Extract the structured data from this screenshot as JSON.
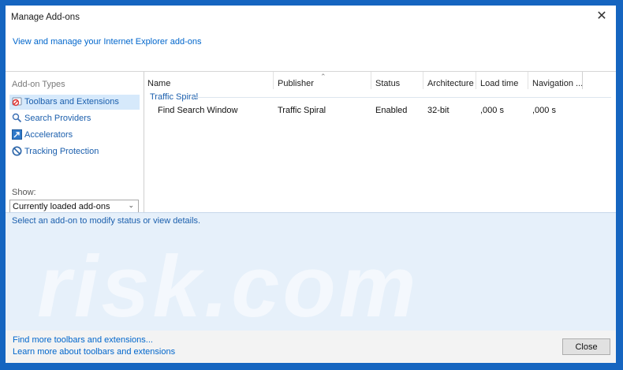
{
  "window": {
    "title": "Manage Add-ons",
    "close_glyph": "✕",
    "header_link": "View and manage your Internet Explorer add-ons"
  },
  "sidebar": {
    "types_label": "Add-on Types",
    "items": [
      {
        "label": "Toolbars and Extensions",
        "icon": "toolbars-extensions-icon",
        "selected": true
      },
      {
        "label": "Search Providers",
        "icon": "search-icon",
        "selected": false
      },
      {
        "label": "Accelerators",
        "icon": "accelerators-icon",
        "selected": false
      },
      {
        "label": "Tracking Protection",
        "icon": "tracking-protection-icon",
        "selected": false
      }
    ],
    "show_label": "Show:",
    "show_value": "Currently loaded add-ons"
  },
  "list": {
    "columns": [
      "Name",
      "Publisher",
      "Status",
      "Architecture",
      "Load time",
      "Navigation ..."
    ],
    "group": "Traffic Spiral",
    "rows": [
      {
        "name": "Find Search Window",
        "publisher": "Traffic Spiral",
        "status": "Enabled",
        "architecture": "32-bit",
        "load_time": ",000 s",
        "navigation": ",000 s"
      }
    ]
  },
  "details": {
    "text": "Select an add-on to modify status or view details.",
    "watermark": "risk.com"
  },
  "footer": {
    "link1": "Find more toolbars and extensions...",
    "link2": "Learn more about toolbars and extensions",
    "close_label": "Close"
  },
  "colors": {
    "accent": "#1565c0",
    "link": "#0066cc",
    "selection": "#d6e9fb",
    "details_bg": "#e6f0fa"
  }
}
